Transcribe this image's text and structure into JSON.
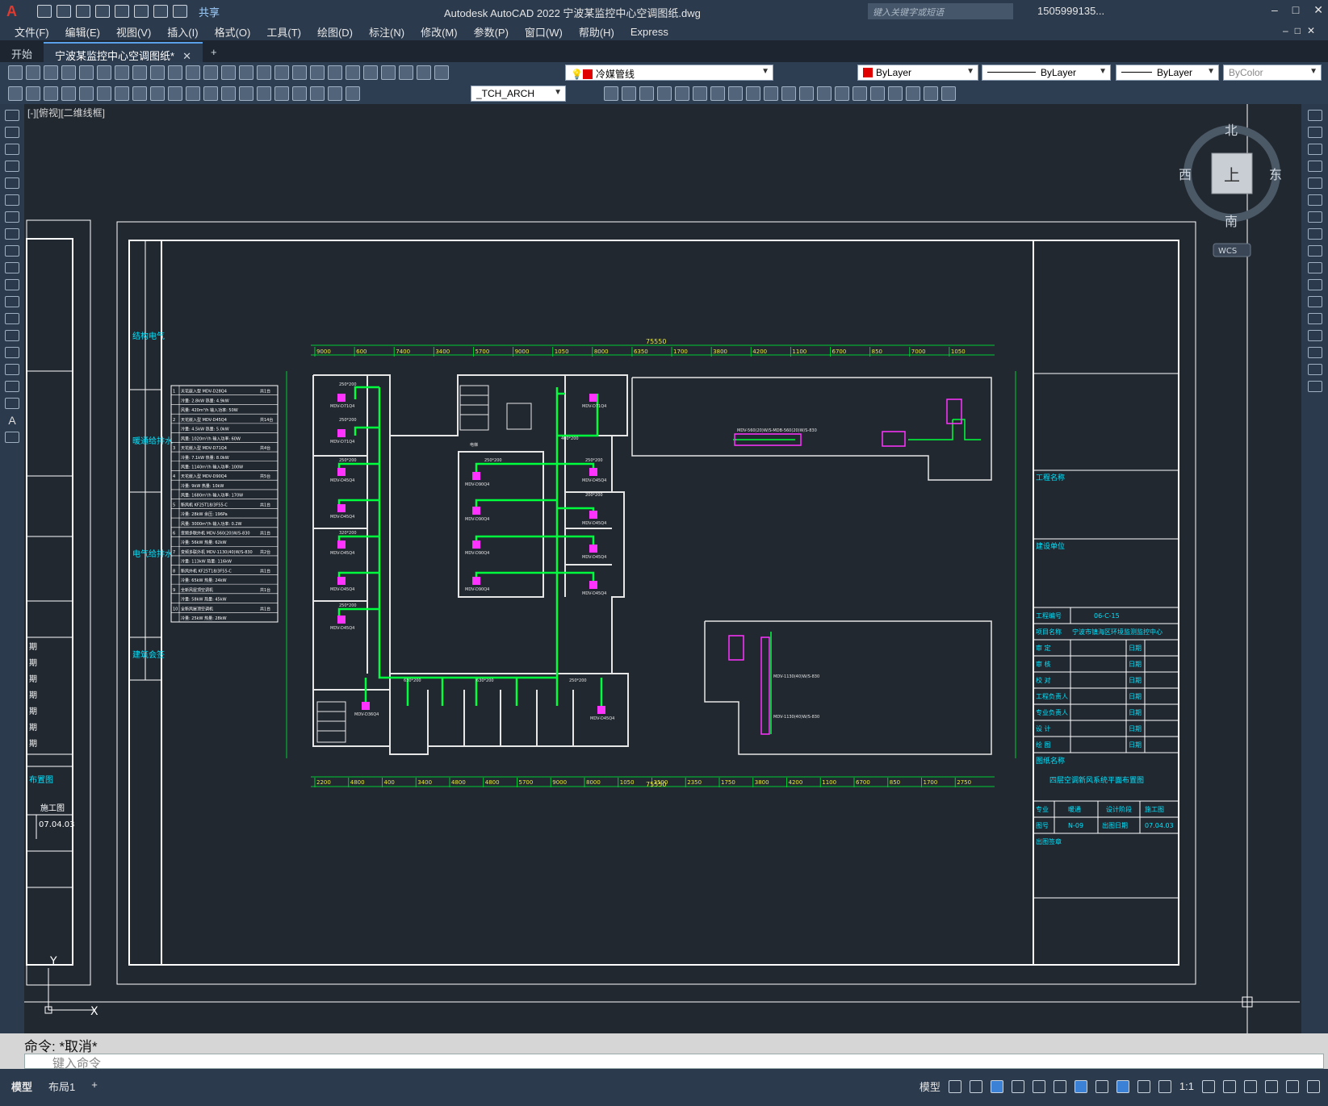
{
  "app": {
    "logo": "A",
    "share": "共享",
    "title": "Autodesk AutoCAD 2022    宁波某监控中心空调图纸.dwg",
    "search_placeholder": "键入关键字或短语",
    "user": "1505999135...",
    "help": "?"
  },
  "menu": [
    "文件(F)",
    "编辑(E)",
    "视图(V)",
    "插入(I)",
    "格式(O)",
    "工具(T)",
    "绘图(D)",
    "标注(N)",
    "修改(M)",
    "参数(P)",
    "窗口(W)",
    "帮助(H)",
    "Express"
  ],
  "tabs": {
    "start": "开始",
    "drawing": "宁波某监控中心空调图纸*",
    "add": "+"
  },
  "toolbar1": {
    "layer": "冷媒管线",
    "color": "ByLayer",
    "linetype": "ByLayer",
    "lineweight": "ByLayer",
    "plotstyle": "ByColor"
  },
  "toolbar2": {
    "textstyle": "_TCH_ARCH"
  },
  "viewport": {
    "label": "[-][俯视][二维线框]",
    "compass": {
      "north": "北",
      "south": "南",
      "east": "东",
      "west": "西",
      "top": "上",
      "wcs": "WCS"
    }
  },
  "drawing": {
    "dim_total": "75550",
    "dims_top": [
      "9000",
      "600",
      "7400",
      "3400",
      "5700",
      "9000",
      "1050",
      "8000",
      "6350",
      "1700",
      "3800",
      "4200",
      "1100",
      "6700",
      "850",
      "7000",
      "1050"
    ],
    "dims_bottom": [
      "2200",
      "4800",
      "400",
      "3400",
      "4800",
      "4800",
      "5700",
      "9000",
      "8000",
      "1050",
      "3500",
      "2350",
      "1750",
      "3800",
      "4200",
      "1100",
      "6700",
      "850",
      "1700",
      "2750"
    ],
    "units": [
      "MDV-D71Q4",
      "MDV-D71Q4",
      "MDV-D45Q4",
      "MDV-D45Q4",
      "MDV-D45Q4",
      "MDV-D45Q4",
      "MDV-D45Q4",
      "MDV-D90Q4",
      "MDV-D90Q4",
      "MDV-D90Q4",
      "MDV-D90Q4",
      "MDV-D45Q4",
      "MDV-D45Q4",
      "MDV-D45Q4",
      "MDV-D45Q4",
      "MDV-D36Q4",
      "MDV-D71Q4",
      "MDV-D45Q4"
    ],
    "duct_labels": [
      "250*200",
      "250*200",
      "250*200",
      "320*200",
      "250*200",
      "250*200",
      "400*200",
      "250*200",
      "200*200",
      "630*200",
      "630*200",
      "250*200"
    ],
    "top_right_unit": "MDV-560(20)W/S-MDB-560(20)W/S-830",
    "right_unit_1": "MDV-1130(40)W/S-830",
    "right_unit_2": "MDV-1130(40)W/S-830",
    "elevator": "电梯"
  },
  "equipment_table": [
    [
      "1",
      "天花嵌入型 MDV-D28Q4",
      "共1台"
    ],
    [
      "",
      "冷量: 2.8kW    热量: 4.9kW",
      ""
    ],
    [
      "",
      "风量: 420m³/h   输入功率: 50W",
      ""
    ],
    [
      "2",
      "天花嵌入型 MDV-D45Q4",
      "共14台"
    ],
    [
      "",
      "冷量: 4.5kW    热量: 5.0kW",
      ""
    ],
    [
      "",
      "风量: 1020m³/h  输入功率: 60W",
      ""
    ],
    [
      "3",
      "天花嵌入型 MDV-D71Q4",
      "共4台"
    ],
    [
      "",
      "冷量: 7.1kW    热量: 8.0kW",
      ""
    ],
    [
      "",
      "风量: 1140m³/h  输入功率: 100W",
      ""
    ],
    [
      "4",
      "天花嵌入型 MDV-D90Q4",
      "共5台"
    ],
    [
      "",
      "冷量: 9kW      热量: 10kW",
      ""
    ],
    [
      "",
      "风量: 1680m³/h  输入功率: 170W",
      ""
    ],
    [
      "5",
      "新风机  KF25T18/3F55-C",
      "共1台"
    ],
    [
      "",
      "冷量: 28kW     余压: 196Pa",
      ""
    ],
    [
      "",
      "风量: 3000m³/h  输入功率: 0.2W",
      ""
    ],
    [
      "6",
      "变频多联外机 MDV-560(20)W/S-830",
      "共1台"
    ],
    [
      "",
      "冷量: 56kW     热量: 62kW",
      ""
    ],
    [
      "7",
      "变频多联外机 MDV-1130(40)W/S-830",
      "共2台"
    ],
    [
      "",
      "冷量: 113kW    热量: 116kW",
      ""
    ],
    [
      "8",
      "新风外机 KF25T18/3F55-C",
      "共1台"
    ],
    [
      "",
      "冷量: 65kW     热量: 24kW",
      ""
    ],
    [
      "9",
      "全新风屋顶空调机",
      "共1台"
    ],
    [
      "",
      "冷量: 58kW     热量: 45kW",
      ""
    ],
    [
      "10",
      "全新风屋顶空调机",
      "共1台"
    ],
    [
      "",
      "冷量: 25kW     热量: 28kW",
      ""
    ]
  ],
  "left_stamp": [
    [
      "给排水",
      "暖通"
    ],
    [
      "电气",
      "结构"
    ],
    [
      "建筑",
      "会签"
    ]
  ],
  "title_block": {
    "project_name_label": "工程名称",
    "client_label": "建设单位",
    "project_no_label": "工程编号",
    "project_no": "06-C-15",
    "item_label": "项目名称",
    "item": "宁波市镇海区环境监测监控中心",
    "roles": [
      "审  定",
      "审  核",
      "校  对",
      "工程负责人",
      "专业负责人",
      "设  计",
      "绘  图"
    ],
    "date_label": "日期",
    "sheet_name_label": "图纸名称",
    "sheet_name": "四层空调新风系统平面布置图",
    "discipline_label": "专业",
    "discipline": "暖通",
    "phase_label": "设计阶段",
    "phase": "施工图",
    "sheet_no_label": "图号",
    "sheet_no": "N-09",
    "issue_date_label": "出图日期",
    "issue_date": "07.04.03",
    "stamp_label": "出图签章"
  },
  "left_partial": {
    "caption": "布置图",
    "label": "施工图",
    "date": "07.04.03",
    "rows": [
      "期",
      "期",
      "期",
      "期",
      "期",
      "期",
      "期"
    ]
  },
  "command": {
    "history": "命令: *取消*",
    "placeholder": "键入命令"
  },
  "status": {
    "model_tab": "模型",
    "layout_tab": "布局1",
    "add": "+",
    "model_btn": "模型",
    "scale": "1:1"
  }
}
